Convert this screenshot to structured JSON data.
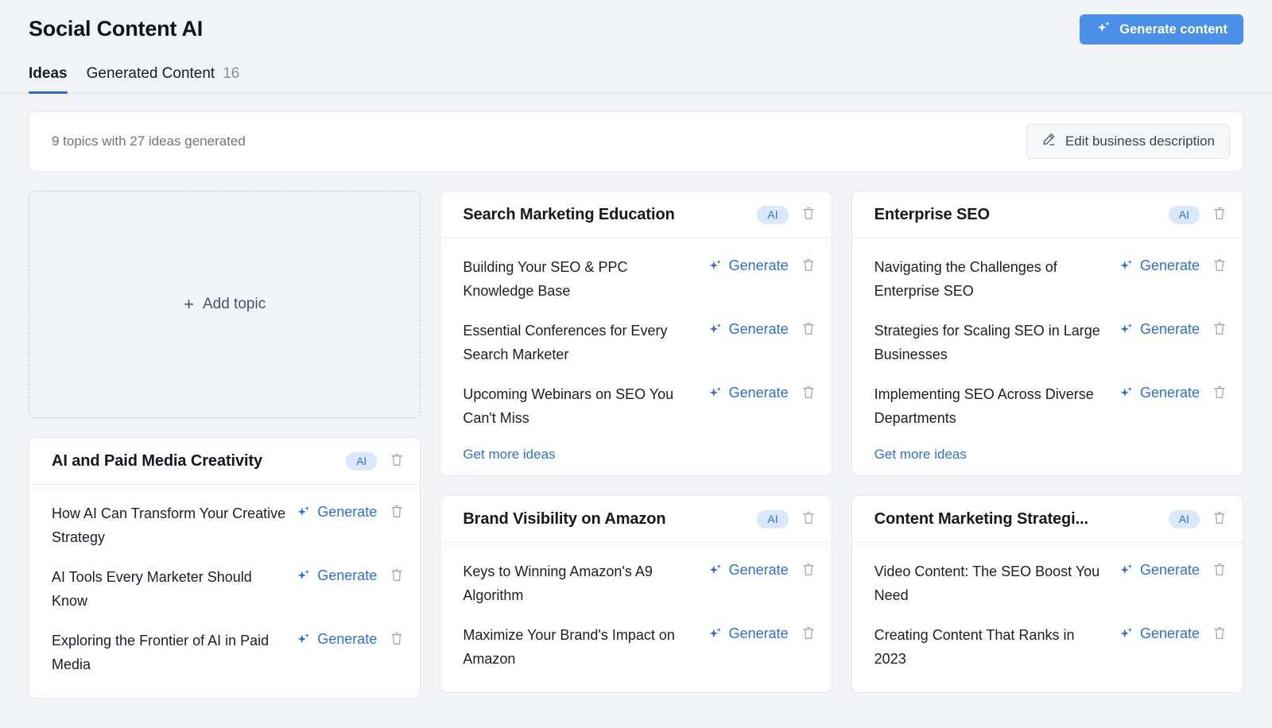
{
  "header": {
    "title": "Social Content AI",
    "generate_button": "Generate content"
  },
  "tabs": [
    {
      "label": "Ideas",
      "count": "",
      "active": true
    },
    {
      "label": "Generated Content",
      "count": "16",
      "active": false
    }
  ],
  "infobar": {
    "summary": "9 topics with 27 ideas generated",
    "edit_button": "Edit business description"
  },
  "add_topic": {
    "label": "Add topic"
  },
  "labels": {
    "ai_badge": "AI",
    "generate": "Generate",
    "get_more_ideas": "Get more ideas"
  },
  "colors": {
    "accent_blue": "#4a90e8",
    "link_blue": "#2f6fd0",
    "tab_underline": "#2d6cc9",
    "badge_bg": "#d9e9fb",
    "page_bg": "#f2f3f7",
    "card_bg": "#ffffff"
  },
  "columns": [
    {
      "cards": [
        {
          "title": "AI and Paid Media Creativity",
          "badge": "AI",
          "has_more": false,
          "ideas": [
            "How AI Can Transform Your Creative Strategy",
            "AI Tools Every Marketer Should Know",
            "Exploring the Frontier of AI in Paid Media"
          ]
        }
      ]
    },
    {
      "cards": [
        {
          "title": "Search Marketing Education",
          "badge": "AI",
          "has_more": true,
          "ideas": [
            "Building Your SEO & PPC Knowledge Base",
            "Essential Conferences for Every Search Marketer",
            "Upcoming Webinars on SEO You Can't Miss"
          ]
        },
        {
          "title": "Brand Visibility on Amazon",
          "badge": "AI",
          "has_more": false,
          "ideas": [
            "Keys to Winning Amazon's A9 Algorithm",
            "Maximize Your Brand's Impact on Amazon"
          ]
        }
      ]
    },
    {
      "cards": [
        {
          "title": "Enterprise SEO",
          "badge": "AI",
          "has_more": true,
          "ideas": [
            "Navigating the Challenges of Enterprise SEO",
            "Strategies for Scaling SEO in Large Businesses",
            "Implementing SEO Across Diverse Departments"
          ]
        },
        {
          "title": "Content Marketing Strategi...",
          "badge": "AI",
          "has_more": false,
          "ideas": [
            "Video Content: The SEO Boost You Need",
            "Creating Content That Ranks in 2023"
          ]
        }
      ]
    }
  ]
}
